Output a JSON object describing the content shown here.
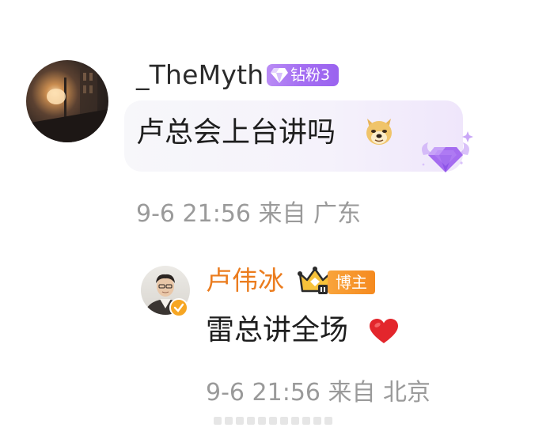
{
  "comment": {
    "username": "_TheMyth",
    "fan_badge": "钻粉3",
    "text": "卢总会上台讲吗",
    "emoji_icon": "doge-emoji-icon",
    "meta": "9-6 21:56 来自 广东",
    "accent": "#a46ef2"
  },
  "reply": {
    "username": "卢伟冰",
    "role_badge": "博主",
    "text": "雷总讲全场",
    "emoji_icon": "red-heart-emoji-icon",
    "meta": "9-6 21:56 来自 北京",
    "name_color": "#eb7c1e"
  }
}
